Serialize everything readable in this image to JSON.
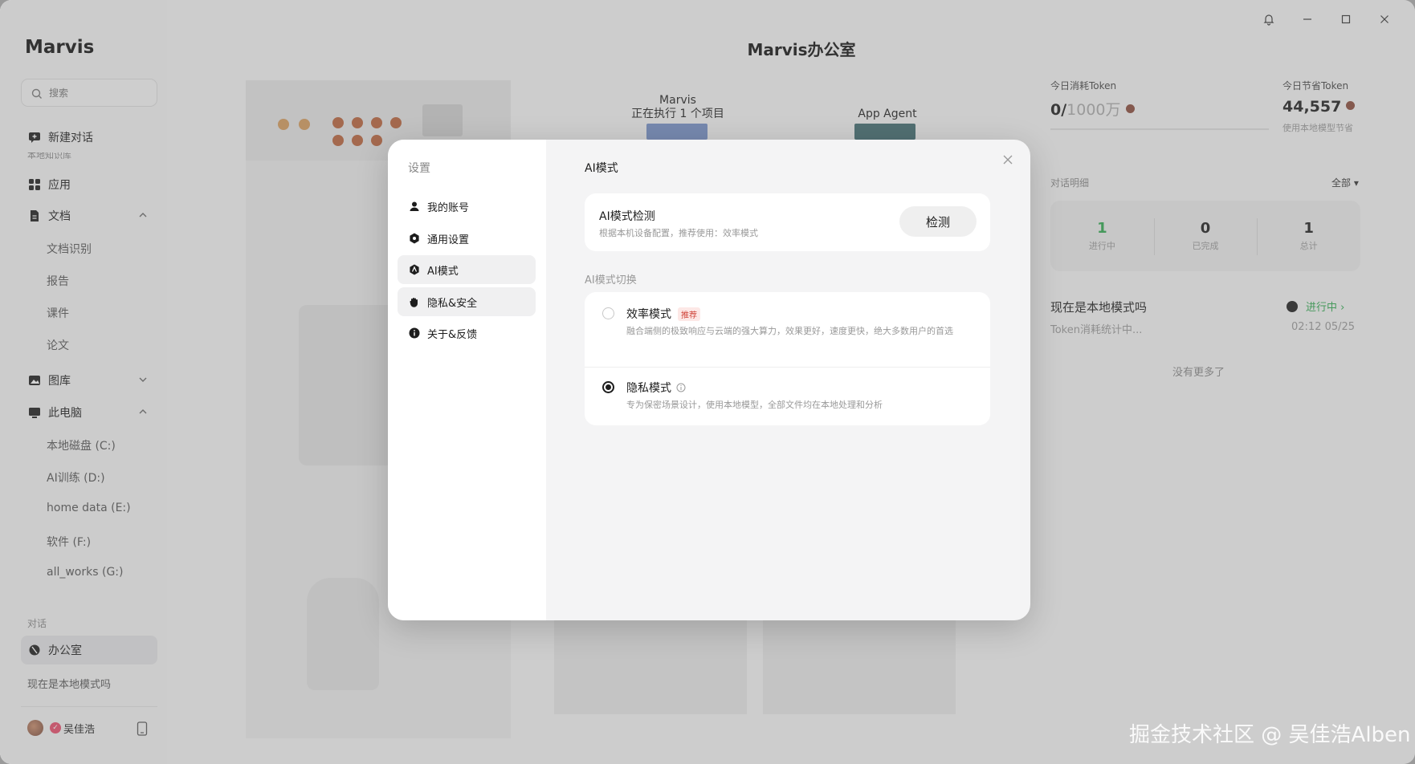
{
  "app": {
    "name": "Marvis",
    "title": "Marvis办公室"
  },
  "search": {
    "placeholder": "搜索"
  },
  "sidebar": {
    "new_chat": "新建对话",
    "ghost_text": "本地知识库",
    "items": {
      "apps": "应用",
      "docs": "文档",
      "gallery": "图库",
      "computer": "此电脑"
    },
    "doc_children": [
      "文档识别",
      "报告",
      "课件",
      "论文"
    ],
    "drives": [
      "本地磁盘 (C:)",
      "AI训练 (D:)",
      "home data (E:)",
      "软件 (F:)",
      "all_works (G:)"
    ],
    "section_conversations": "对话",
    "office": "办公室",
    "conversation_item": "现在是本地模式吗",
    "user_name": "吴佳浩"
  },
  "scene": {
    "agent1_name": "Marvis",
    "agent1_status": "正在执行 1 个项目",
    "agent2_name": "App Agent"
  },
  "stats": {
    "today_used_label": "今日消耗Token",
    "today_used_value": "0/",
    "today_used_limit": "1000万",
    "today_saved_label": "今日节省Token",
    "today_saved_value": "44,557",
    "today_saved_sub": "使用本地模型节省",
    "detail_title": "对话明细",
    "filter": "全部 ▾",
    "counts": [
      {
        "num": "1",
        "label": "进行中",
        "color": "#2fa84f"
      },
      {
        "num": "0",
        "label": "已完成",
        "color": "#1d1d1d"
      },
      {
        "num": "1",
        "label": "总计",
        "color": "#1d1d1d"
      }
    ],
    "conv_title": "现在是本地模式吗",
    "conv_sub": "Token消耗统计中...",
    "conv_status": "进行中 ›",
    "conv_time": "02:12 05/25",
    "no_more": "没有更多了"
  },
  "settings": {
    "heading": "设置",
    "nav": [
      "我的账号",
      "通用设置",
      "AI模式",
      "隐私&安全",
      "关于&反馈"
    ],
    "active_nav": "AI模式",
    "panel_title": "AI模式",
    "check_title": "AI模式检测",
    "check_sub": "根据本机设备配置，推荐使用：效率模式",
    "check_button": "检测",
    "switch_label": "AI模式切换",
    "modes": [
      {
        "name": "效率模式",
        "badge": "推荐",
        "desc": "融合端侧的极致响应与云端的强大算力，效果更好，速度更快，绝大多数用户的首选",
        "selected": false
      },
      {
        "name": "隐私模式",
        "desc": "专为保密场景设计，使用本地模型，全部文件均在本地处理和分析",
        "selected": true
      }
    ]
  },
  "watermark": "掘金技术社区 @ 吴佳浩Alben"
}
